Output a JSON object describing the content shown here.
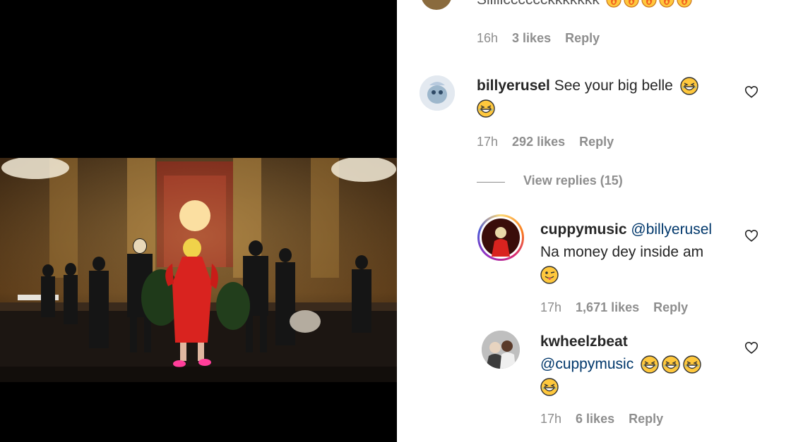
{
  "partial_comment": {
    "text": "Siiiiicccccckkkkkkk",
    "emoji_names": [
      "fire-emoji",
      "fire-emoji",
      "fire-emoji",
      "fire-emoji",
      "fire-emoji"
    ],
    "time": "16h",
    "likes": "3 likes",
    "reply": "Reply"
  },
  "comments": [
    {
      "username": "billyerusel",
      "text": "See your big belle",
      "emoji_names": [
        "laughing-emoji",
        "laughing-emoji"
      ],
      "time": "17h",
      "likes": "292 likes",
      "reply": "Reply",
      "view_replies": "View replies (15)"
    }
  ],
  "replies": [
    {
      "username": "cuppymusic",
      "mention": "@billyerusel",
      "text": "Na money dey inside am",
      "emoji_names": [
        "winking-tongue-emoji"
      ],
      "time": "17h",
      "likes": "1,671 likes",
      "reply": "Reply"
    },
    {
      "username": "kwheelzbeat",
      "mention": "@cuppymusic",
      "text": "",
      "emoji_names": [
        "laughing-emoji",
        "laughing-emoji",
        "laughing-emoji",
        "laughing-emoji"
      ],
      "time": "17h",
      "likes": "6 likes",
      "reply": "Reply"
    }
  ],
  "colors": {
    "text": "#262626",
    "secondary": "#8e8e8e",
    "mention": "#00376b",
    "media_bg": "#000000",
    "dress": "#d9231f"
  }
}
